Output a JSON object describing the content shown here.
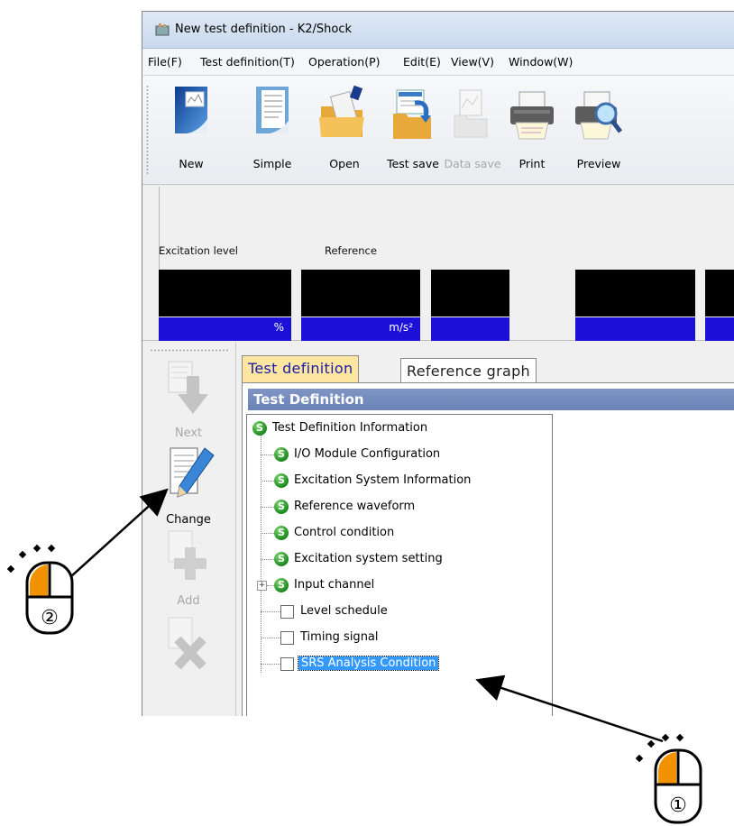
{
  "window": {
    "title": "New test definition - K2/Shock"
  },
  "menu": [
    "File(F)",
    "Test definition(T)",
    "Operation(P)",
    "Edit(E)",
    "View(V)",
    "Window(W)"
  ],
  "toolbar": {
    "items": [
      {
        "label": "New",
        "icon": "new-document-icon",
        "enabled": true
      },
      {
        "label": "Simple",
        "icon": "simple-document-icon",
        "enabled": true
      },
      {
        "label": "Open",
        "icon": "open-folder-icon",
        "enabled": true
      },
      {
        "label": "Test save",
        "icon": "test-save-icon",
        "enabled": true
      },
      {
        "label": "Data save",
        "icon": "data-save-icon",
        "enabled": false
      },
      {
        "label": "Print",
        "icon": "printer-icon",
        "enabled": true
      },
      {
        "label": "Preview",
        "icon": "print-preview-icon",
        "enabled": true
      }
    ]
  },
  "meters": {
    "labels": [
      "Excitation level",
      "Reference"
    ],
    "units": [
      "%",
      "m/s²",
      "",
      "",
      ""
    ]
  },
  "sidebar": {
    "buttons": [
      {
        "label": "Next",
        "icon": "down-arrow-icon",
        "enabled": false
      },
      {
        "label": "Change",
        "icon": "pencil-edit-icon",
        "enabled": true
      },
      {
        "label": "Add",
        "icon": "plus-icon",
        "enabled": false
      },
      {
        "label": "",
        "icon": "delete-x-icon",
        "enabled": false
      }
    ]
  },
  "tabs": [
    {
      "label": "Test definition",
      "active": true
    },
    {
      "label": "Reference graph",
      "active": false
    }
  ],
  "panel": {
    "header": "Test Definition"
  },
  "tree": {
    "root": {
      "label": "Test Definition Information",
      "status": "set"
    },
    "children": [
      {
        "label": "I/O Module Configuration",
        "status": "set"
      },
      {
        "label": "Excitation System Information",
        "status": "set"
      },
      {
        "label": "Reference waveform",
        "status": "set"
      },
      {
        "label": "Control condition",
        "status": "set"
      },
      {
        "label": "Excitation system setting",
        "status": "set"
      },
      {
        "label": "Input channel",
        "status": "set",
        "expandable": true
      },
      {
        "label": "Level schedule",
        "status": "unset"
      },
      {
        "label": "Timing signal",
        "status": "unset"
      },
      {
        "label": "SRS Analysis Condition",
        "status": "unset",
        "selected": true
      }
    ]
  },
  "annotations": {
    "step1": "①",
    "step2": "②",
    "mouse_color": "#f39200"
  }
}
